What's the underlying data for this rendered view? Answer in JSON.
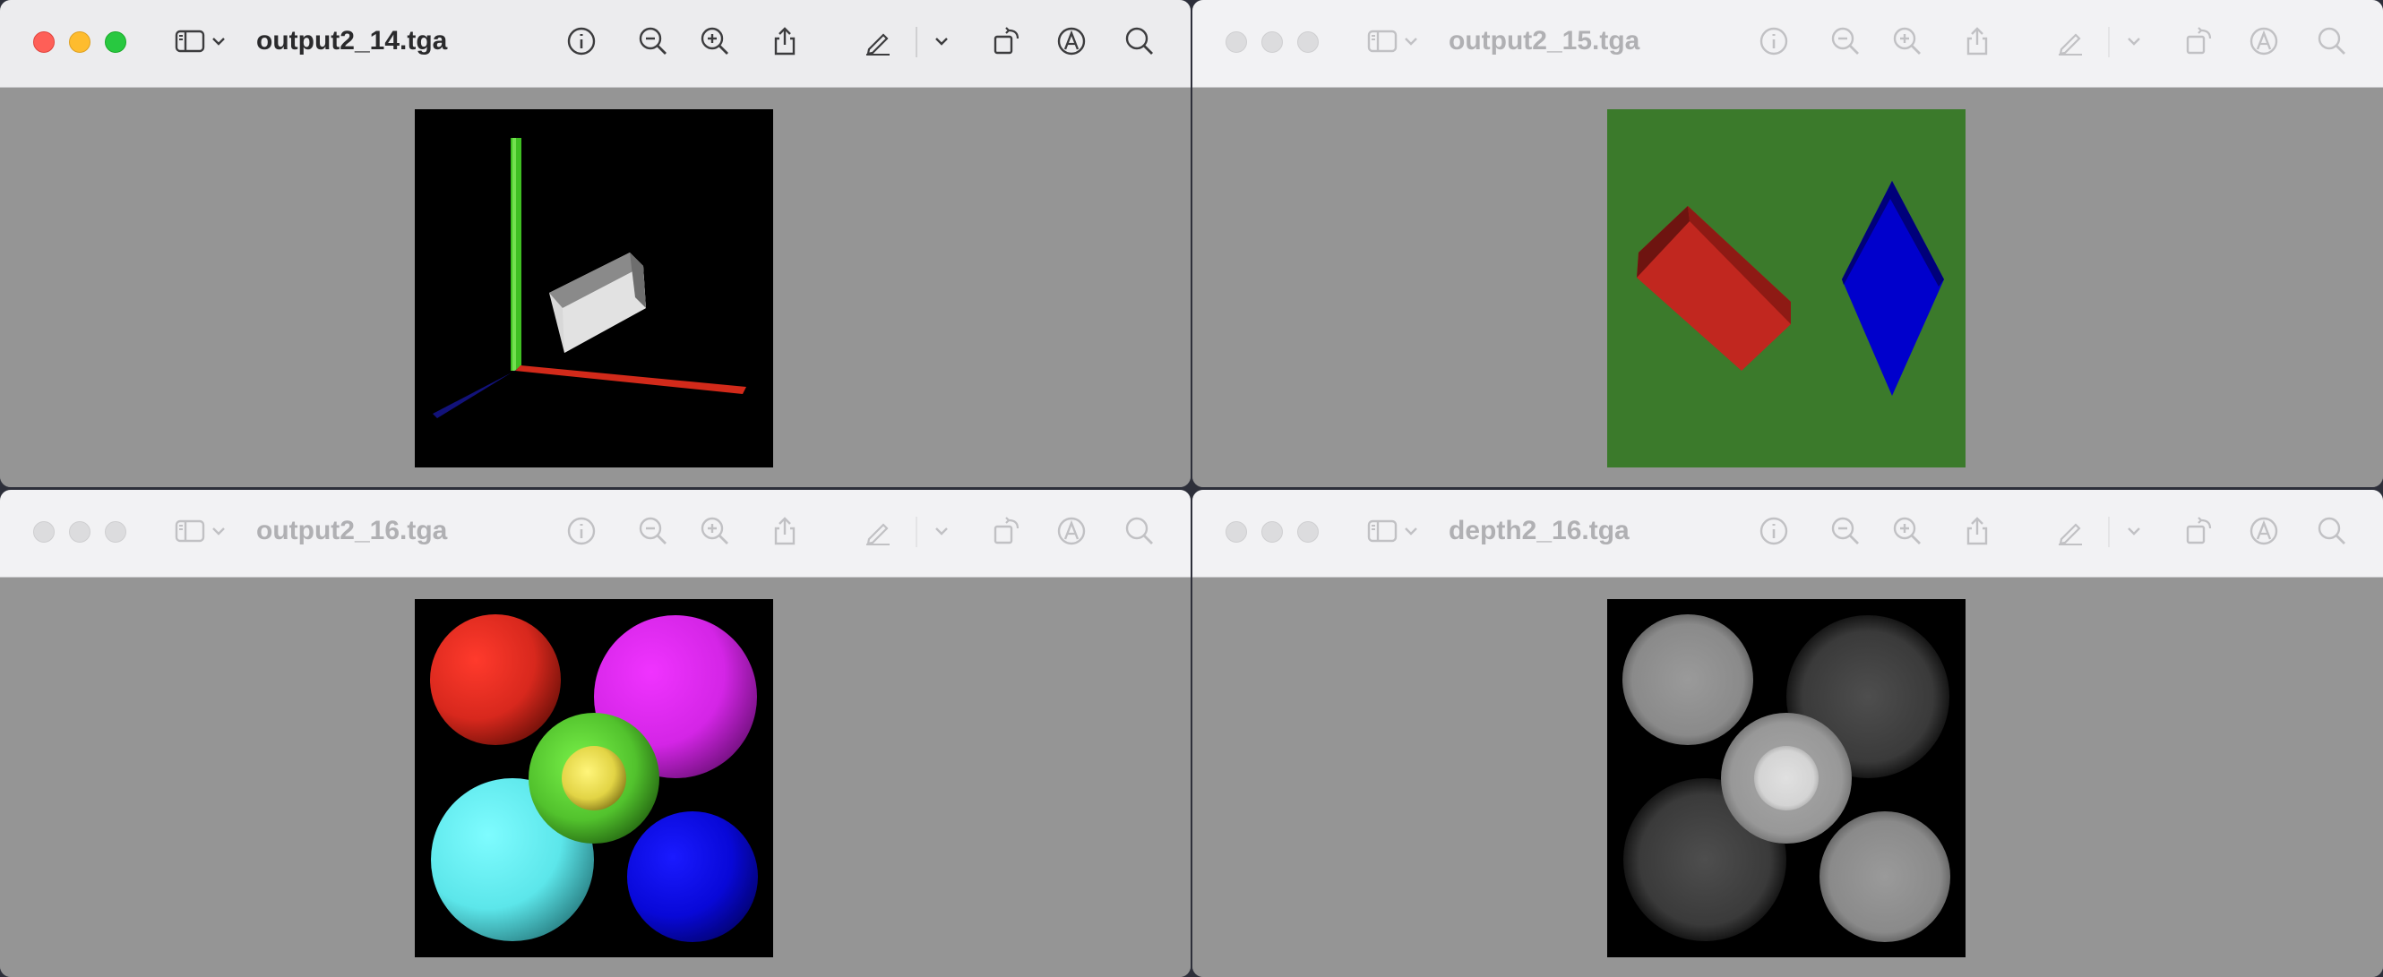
{
  "windows": [
    {
      "title": "output2_14.tga",
      "active": true
    },
    {
      "title": "output2_15.tga",
      "active": false
    },
    {
      "title": "output2_16.tga",
      "active": false
    },
    {
      "title": "depth2_16.tga",
      "active": false
    }
  ],
  "toolbar_icons": [
    "sidebar-icon",
    "chevron-down-icon",
    "info-icon",
    "zoom-out-icon",
    "zoom-in-icon",
    "share-icon",
    "markup-pencil-icon",
    "chevron-down-icon",
    "rotate-icon",
    "markup-a-icon",
    "search-icon"
  ]
}
